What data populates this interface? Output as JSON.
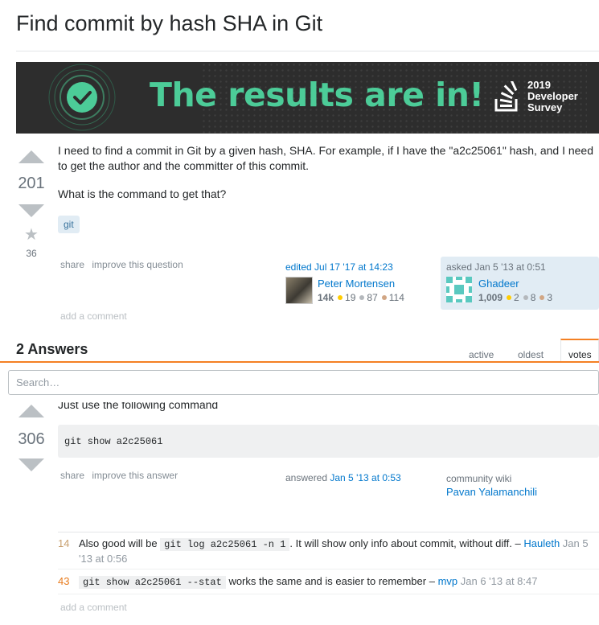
{
  "question": {
    "title": "Find commit by hash SHA in Git",
    "votes": "201",
    "favorites": "36",
    "body_p1": "I need to find a commit in Git by a given hash, SHA. For example, if I have the \"a2c25061\" hash, and I need to get the author and the committer of this commit.",
    "body_p2": "What is the command to get that?",
    "tag": "git",
    "menu": {
      "share": "share",
      "improve": "improve this question"
    },
    "editor": {
      "action": "edited",
      "time": "Jul 17 '17 at 14:23",
      "name": "Peter Mortensen",
      "rep": "14k",
      "gold": "19",
      "silver": "87",
      "bronze": "114"
    },
    "asker": {
      "action": "asked",
      "time": "Jan 5 '13 at 0:51",
      "name": "Ghadeer",
      "rep": "1,009",
      "gold": "2",
      "silver": "8",
      "bronze": "3"
    },
    "add_comment": "add a comment"
  },
  "banner": {
    "headline": "The results are in!",
    "survey_line1": "2019",
    "survey_line2": "Developer",
    "survey_line3": "Survey"
  },
  "answers": {
    "header": "2 Answers",
    "tabs": [
      "active",
      "oldest",
      "votes"
    ]
  },
  "search": {
    "placeholder": "Search…"
  },
  "answer": {
    "text": "Just use the following command",
    "votes": "306",
    "code": "git show a2c25061",
    "menu": {
      "share": "share",
      "improve": "improve this answer"
    },
    "answered_label": "answered",
    "answered_time": "Jan 5 '13 at 0:53",
    "wiki_label": "community wiki",
    "wiki_user": "Pavan Yalamanchili",
    "add_comment": "add a comment"
  },
  "comments": [
    {
      "score": "14",
      "pre": "Also good will be ",
      "code": "git log a2c25061 -n 1",
      "post": ". It will show only info about commit, without diff. – ",
      "user": "Hauleth",
      "time": "Jan 5 '13 at 0:56"
    },
    {
      "score": "43",
      "pre": "",
      "code": "git show a2c25061 --stat",
      "post": " works the same and is easier to remember – ",
      "user": "mvp",
      "time": "Jan 6 '13 at 8:47"
    }
  ],
  "colors": {
    "accent": "#f48024",
    "link": "#0077cc",
    "banner_green": "#4ccc98",
    "gold": "#ffcc01",
    "silver": "#b4b8bc",
    "bronze": "#d1a684",
    "asker_bg": "#e1ecf4"
  }
}
